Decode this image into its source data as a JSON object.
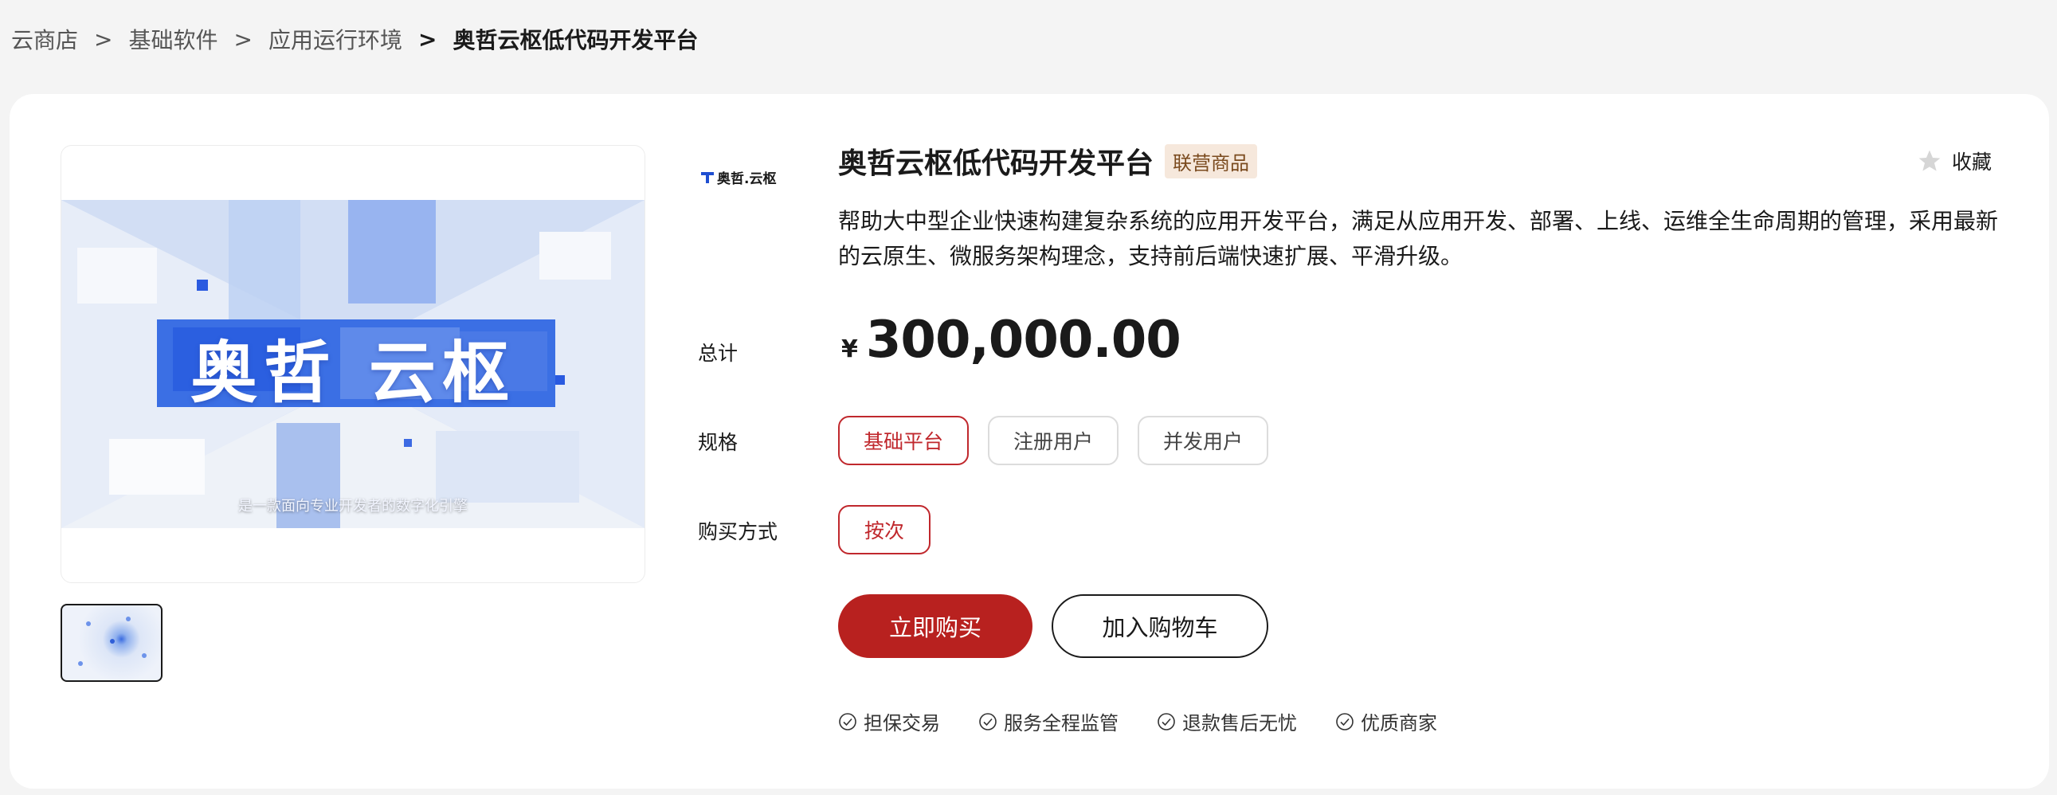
{
  "breadcrumb": {
    "items": [
      "云商店",
      "基础软件",
      "应用运行环境",
      "奥哲云枢低代码开发平台"
    ],
    "separator": ">"
  },
  "gallery": {
    "hero_title_left": "奥哲",
    "hero_title_right": "云枢",
    "hero_caption": "是一款面向专业开发者的数字化引擎"
  },
  "vendor": {
    "logo_text": "奥哲.云枢"
  },
  "product": {
    "title": "奥哲云枢低代码开发平台",
    "badge": "联营商品",
    "favorite_label": "收藏",
    "description": "帮助大中型企业快速构建复杂系统的应用开发平台，满足从应用开发、部署、上线、运维全生命周期的管理，采用最新的云原生、微服务架构理念，支持前后端快速扩展、平滑升级。"
  },
  "pricing": {
    "label": "总计",
    "currency": "¥",
    "amount": "300,000.00"
  },
  "spec": {
    "label": "规格",
    "options": [
      "基础平台",
      "注册用户",
      "并发用户"
    ],
    "selected": "基础平台"
  },
  "purchase_mode": {
    "label": "购买方式",
    "options": [
      "按次"
    ],
    "selected": "按次"
  },
  "actions": {
    "buy_now": "立即购买",
    "add_to_cart": "加入购物车"
  },
  "guarantees": [
    "担保交易",
    "服务全程监管",
    "退款售后无忧",
    "优质商家"
  ],
  "colors": {
    "accent": "#b8211f",
    "selected_border": "#c0282d",
    "badge_bg": "#f6e8dc",
    "page_bg": "#f4f4f4"
  },
  "icons": {
    "favorite": "star-icon",
    "guarantee": "check-circle-icon"
  }
}
